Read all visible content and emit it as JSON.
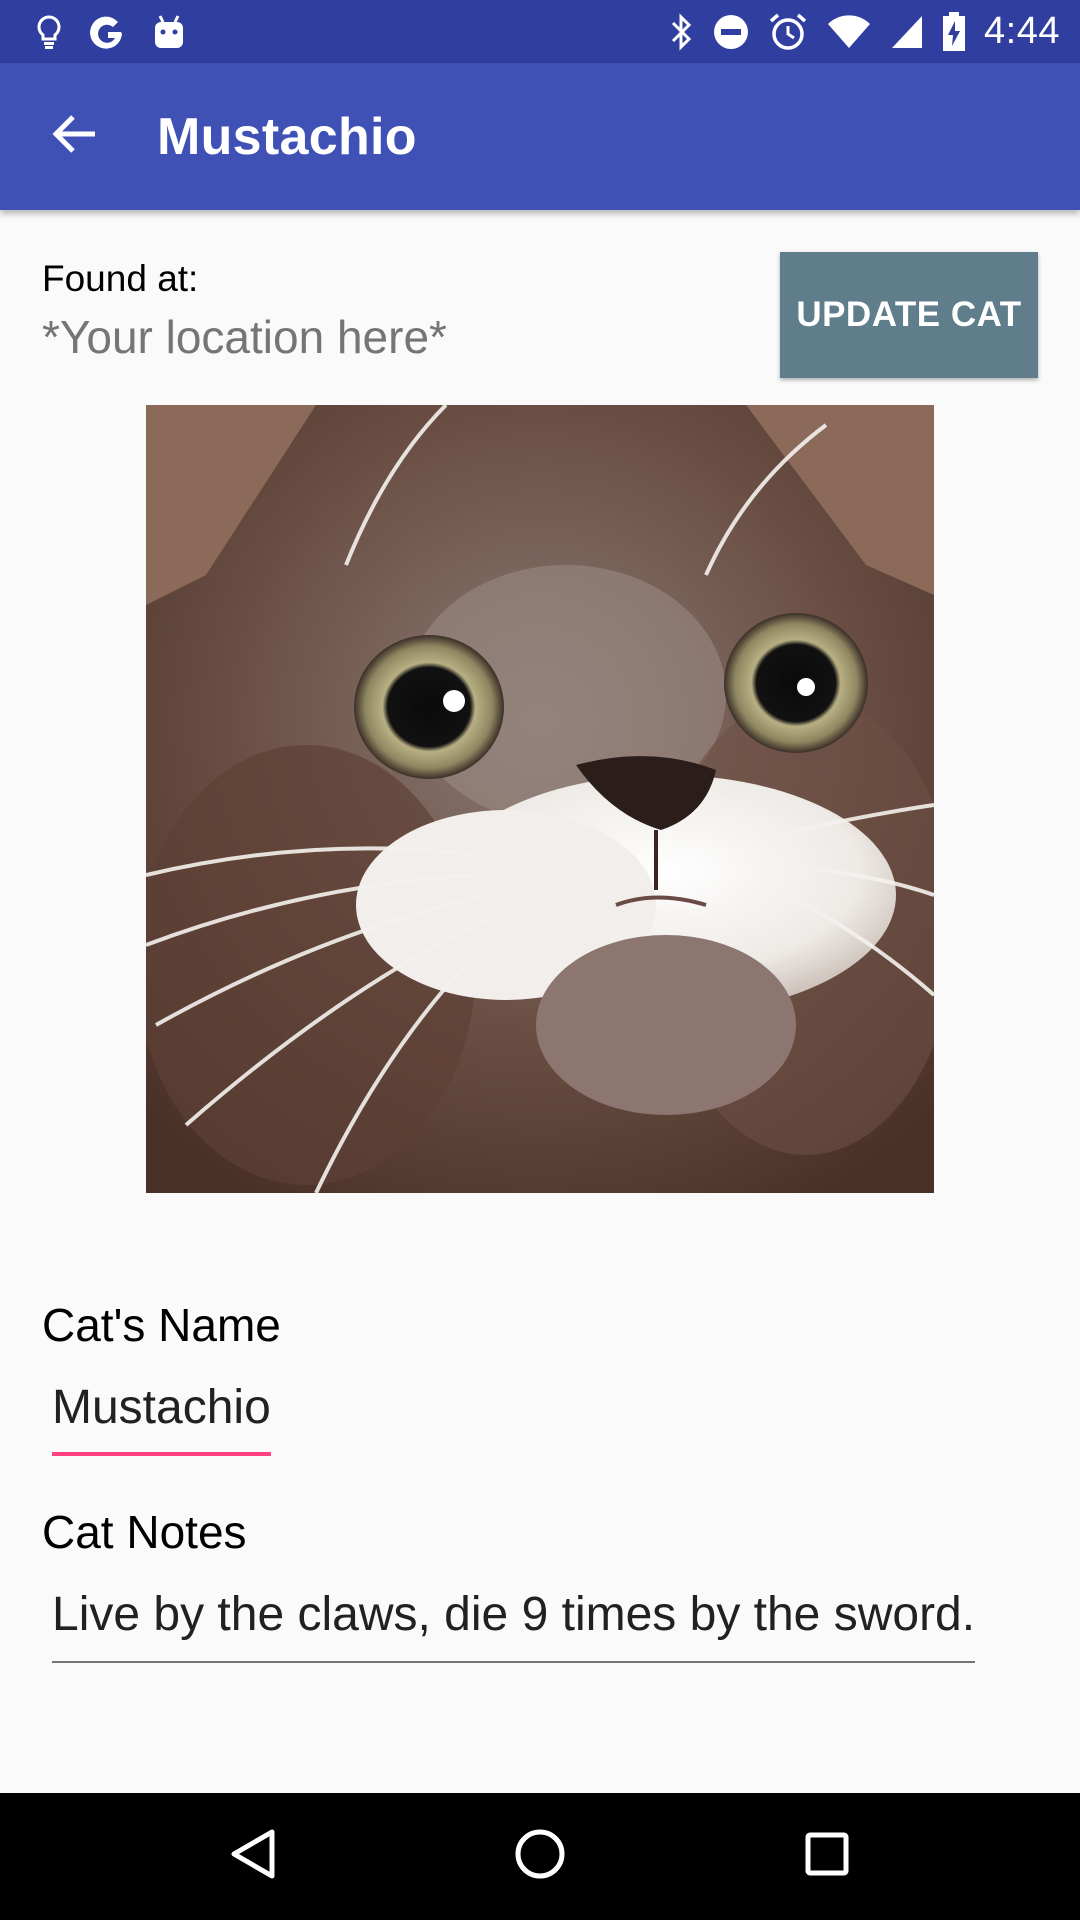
{
  "status_bar": {
    "time": "4:44",
    "left_icons": [
      "lightbulb-icon",
      "google-icon",
      "android-icon"
    ],
    "right_icons": [
      "bluetooth-icon",
      "do-not-disturb-icon",
      "alarm-icon",
      "wifi-icon",
      "cellular-signal-icon",
      "battery-charging-icon"
    ]
  },
  "app_bar": {
    "title": "Mustachio",
    "back_icon": "arrow-back-icon"
  },
  "location": {
    "label": "Found at:",
    "value": "*Your location here*"
  },
  "update_button": {
    "label": "UPDATE CAT"
  },
  "cat_photo": {
    "icon": "cat-photo"
  },
  "name_field": {
    "label": "Cat's Name",
    "value": "Mustachio"
  },
  "notes_field": {
    "label": "Cat Notes",
    "value": "Live by the claws, die 9 times by the sword."
  },
  "nav_bar": {
    "buttons": [
      "back-triangle-icon",
      "home-circle-icon",
      "recents-square-icon"
    ]
  },
  "colors": {
    "status_bar": "#303F9F",
    "app_bar": "#3F51B5",
    "button": "#607D8B",
    "accent": "#FF4081",
    "background": "#FAFAFA"
  }
}
